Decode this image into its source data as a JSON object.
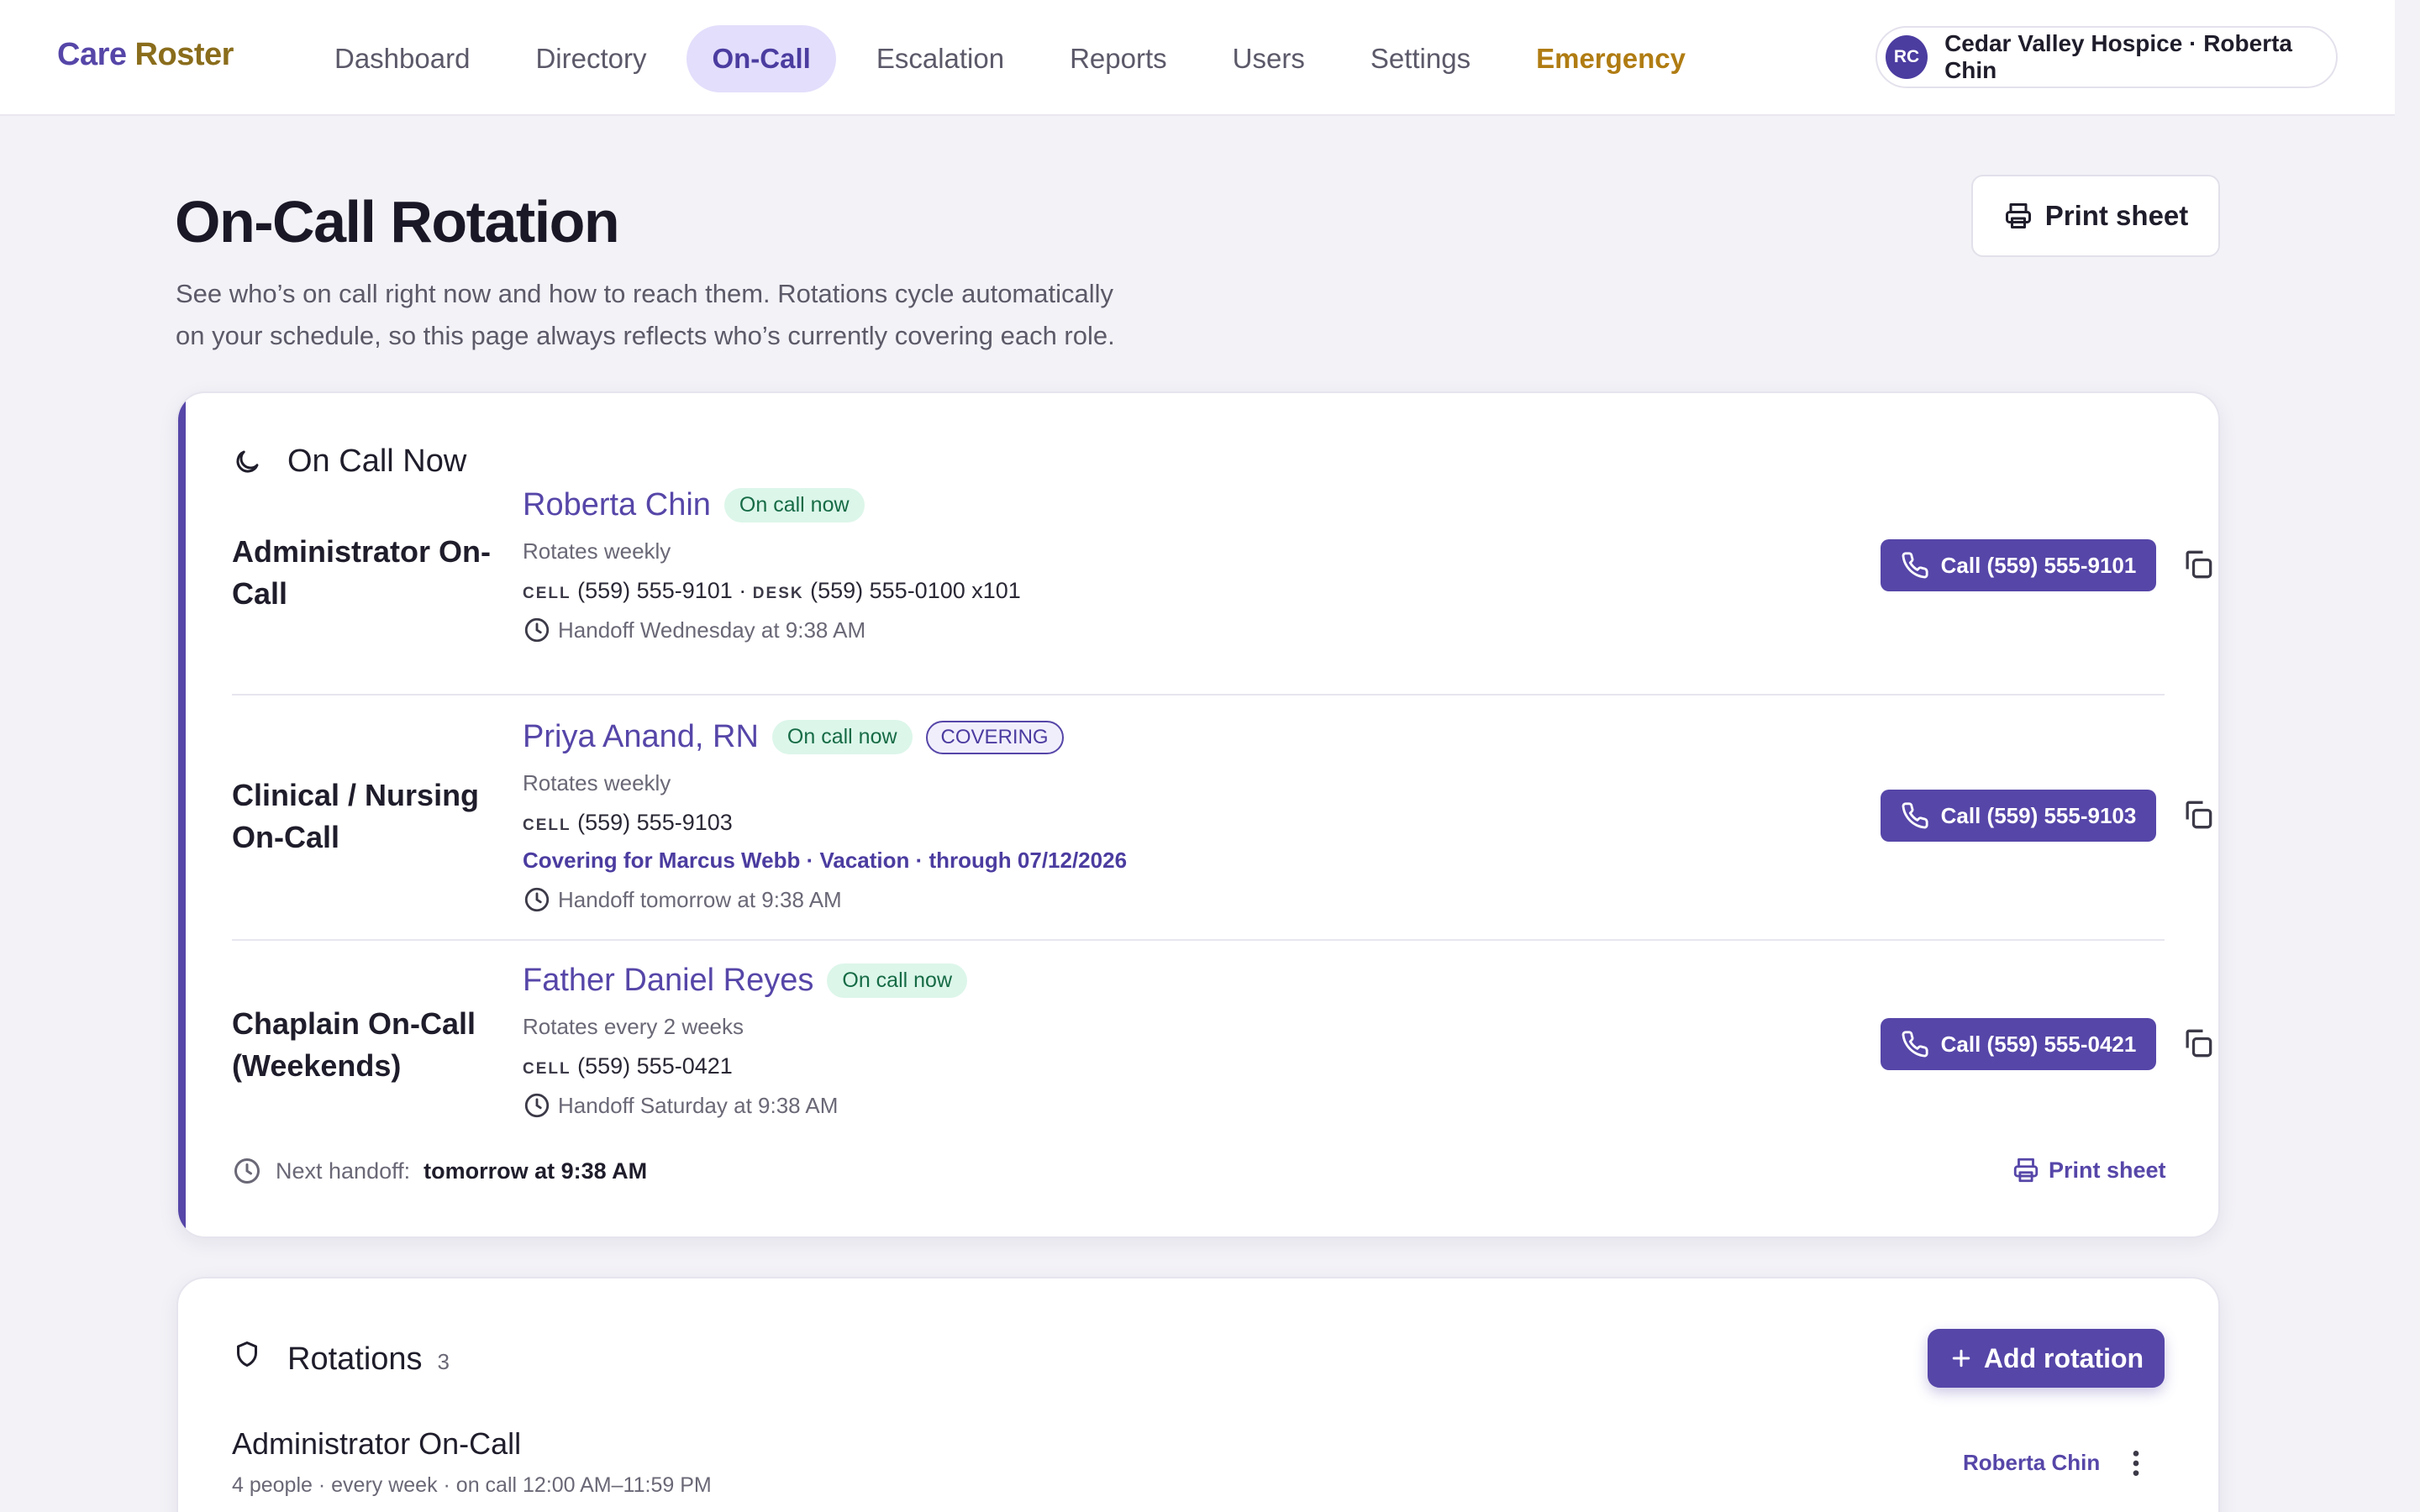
{
  "brand": {
    "part1": "Care",
    "part2": " Roster"
  },
  "nav": {
    "items": [
      {
        "label": "Dashboard"
      },
      {
        "label": "Directory"
      },
      {
        "label": "On-Call",
        "active": true
      },
      {
        "label": "Escalation"
      },
      {
        "label": "Reports"
      },
      {
        "label": "Users"
      },
      {
        "label": "Settings"
      },
      {
        "label": "Emergency",
        "emphasis": true
      }
    ]
  },
  "account": {
    "initials": "RC",
    "label": "Cedar Valley Hospice · Roberta Chin"
  },
  "header": {
    "title": "On-Call Rotation",
    "description": "See who’s on call right now and how to reach them. Rotations cycle automatically on your schedule, so this page always reflects who’s currently covering each role.",
    "print_label": "Print sheet"
  },
  "on_call_now": {
    "title": "On Call Now",
    "rows": [
      {
        "role": "Administrator On-Call",
        "name": "Roberta Chin",
        "status": "On call now",
        "rotation": "Rotates weekly",
        "cell_tag": "CELL",
        "cell": "(559) 555-9101",
        "desk_tag": "DESK",
        "desk": "(559) 555-0100 x101",
        "handoff": "Handoff Wednesday at 9:38 AM",
        "call_label": "Call (559) 555-9101"
      },
      {
        "role": "Clinical / Nursing On-Call",
        "name": "Priya Anand, RN",
        "status": "On call now",
        "covering_badge": "COVERING",
        "rotation": "Rotates weekly",
        "cell_tag": "CELL",
        "cell": "(559) 555-9103",
        "covering_note": "Covering for Marcus Webb · Vacation · through 07/12/2026",
        "handoff": "Handoff tomorrow at 9:38 AM",
        "call_label": "Call (559) 555-9103"
      },
      {
        "role": "Chaplain On-Call (Weekends)",
        "name": "Father Daniel Reyes",
        "status": "On call now",
        "rotation": "Rotates every 2 weeks",
        "cell_tag": "CELL",
        "cell": "(559) 555-0421",
        "handoff": "Handoff Saturday at 9:38 AM",
        "call_label": "Call (559) 555-0421"
      }
    ],
    "footer": {
      "next_label": "Next handoff:",
      "next_value": "tomorrow at 9:38 AM",
      "print_label": "Print sheet"
    }
  },
  "rotations": {
    "title": "Rotations",
    "count": "3",
    "add_label": "Add rotation",
    "items": [
      {
        "title": "Administrator On-Call",
        "meta": "4 people · every week · on call 12:00 AM–11:59 PM",
        "current": "Roberta Chin"
      }
    ]
  },
  "colors": {
    "accent": "#5646a8",
    "emergency": "#b07c12",
    "on_call_green": "#dcf6ea"
  }
}
